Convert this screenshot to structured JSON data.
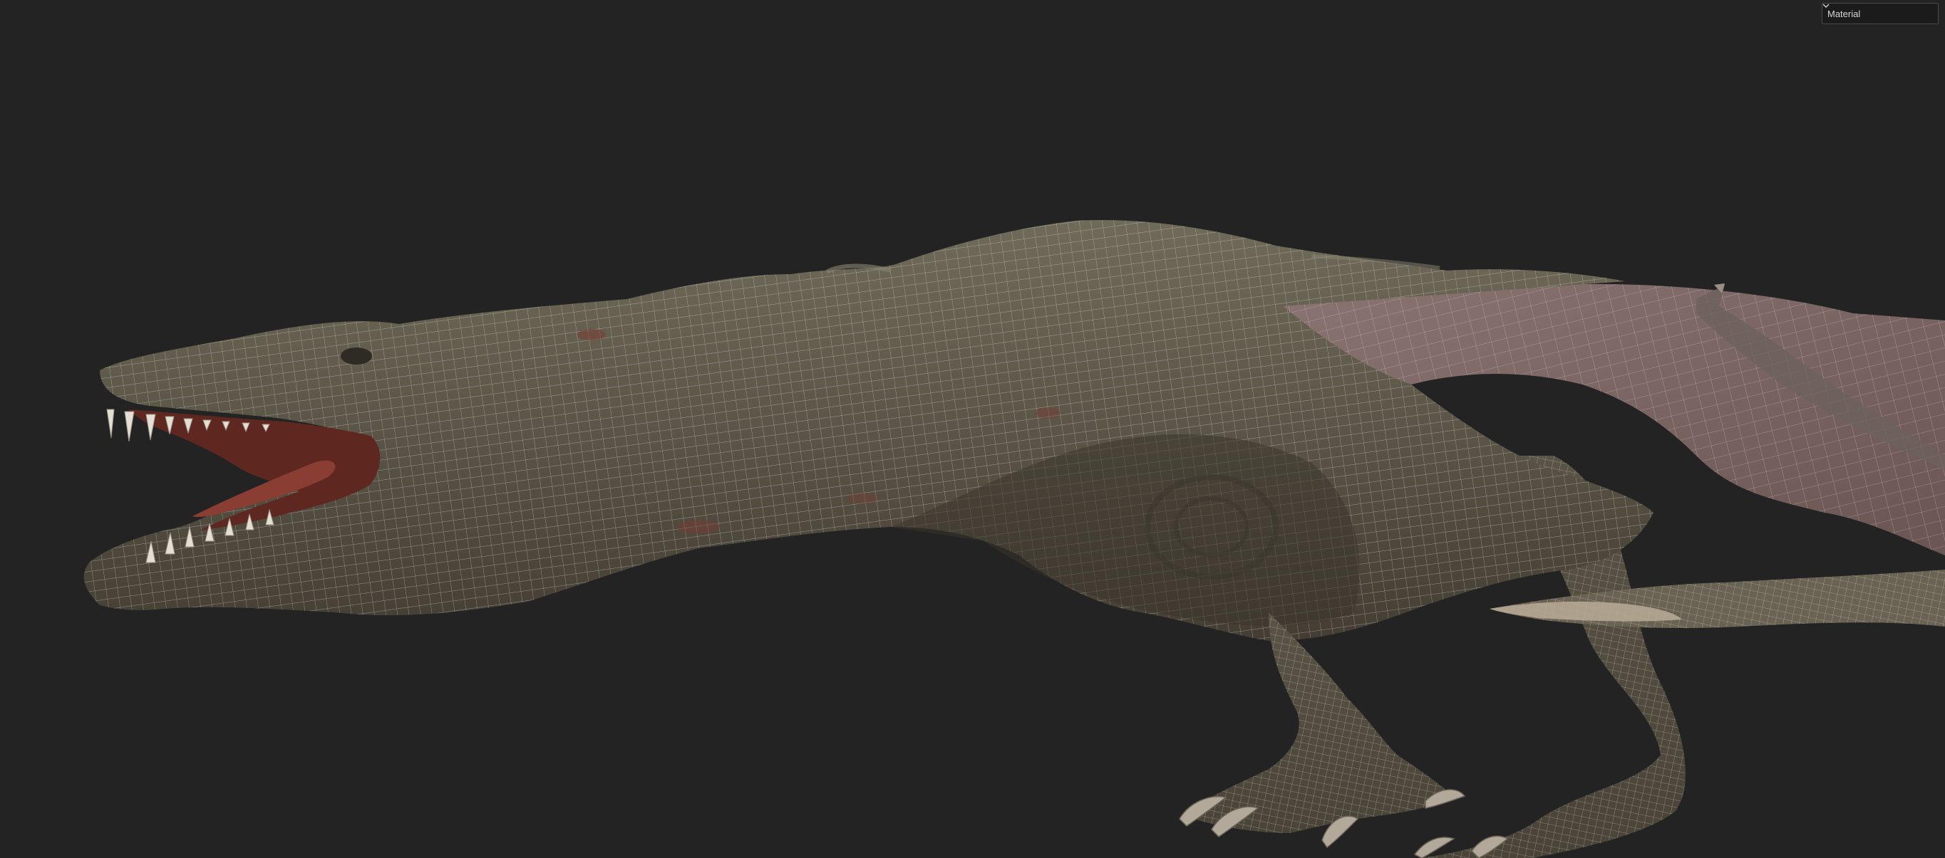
{
  "viewport": {
    "background": "#232323",
    "subject": "dragon-model"
  },
  "shading_dropdown": {
    "selected": "Material",
    "icon": "chevron-down-icon"
  },
  "colors": {
    "skin": "#5f5a4c",
    "skin_dark": "#3f3a31",
    "skin_light": "#7a7463",
    "wing_membrane": "#7e6a68",
    "mouth_interior": "#7a3026",
    "wireframe": "#d9d9d9"
  }
}
